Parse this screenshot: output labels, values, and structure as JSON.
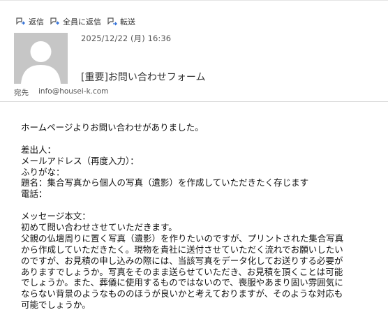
{
  "toolbar": {
    "reply": "返信",
    "reply_all": "全員に返信",
    "forward": "転送"
  },
  "header": {
    "date": "2025/12/22 (月) 16:36",
    "subject": "[重要]お問い合わせフォーム",
    "recipient_label": "宛先",
    "recipient": "info@housei-k.com"
  },
  "body": {
    "lines": [
      "ホームページよりお問い合わせがありました。",
      "",
      "差出人：",
      "メールアドレス（再度入力）：",
      "ふりがな：",
      "題名：集合写真から個人の写真（遺影）を作成していただきたく存じます",
      "電話：",
      "",
      "メッセージ本文：",
      "初めて問い合わせさせていただきます。",
      "父親の仏壇周りに置く写真（遺影）を作りたいのですが、プリントされた集合写真",
      "から作成していただきたく。現物を貴社に送付させていただく流れでお願いしたい",
      "のですが、お見積の申し込みの際には、当該写真をデータ化してお送りする必要が",
      "ありますでしょうか。写真をそのまま送らせていただき、お見積を頂くことは可能",
      "でしょうか。また、葬儀に使用するものではないので、喪服やあまり固い雰囲気に",
      "ならない背景のようなもののほうが良いかと考えておりますが、そのような対応も",
      "可能でしょうか。"
    ]
  }
}
